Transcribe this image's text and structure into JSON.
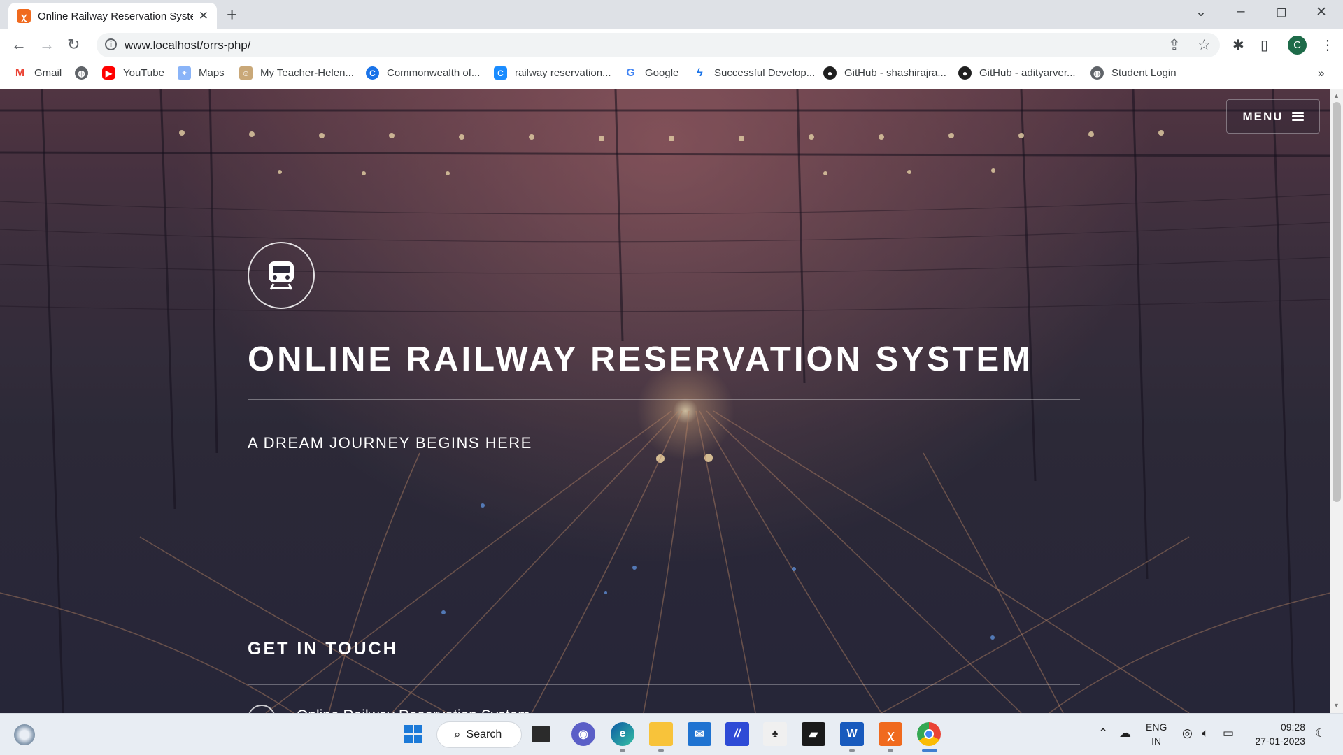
{
  "browser": {
    "tab_title": "Online Railway Reservation Syste",
    "url": "www.localhost/orrs-php/",
    "profile_initial": "C",
    "bookmarks": [
      {
        "label": "Gmail"
      },
      {
        "label": ""
      },
      {
        "label": "YouTube"
      },
      {
        "label": "Maps"
      },
      {
        "label": "My Teacher-Helen..."
      },
      {
        "label": "Commonwealth of..."
      },
      {
        "label": "railway reservation..."
      },
      {
        "label": "Google"
      },
      {
        "label": "Successful Develop..."
      },
      {
        "label": "GitHub - shashirajra..."
      },
      {
        "label": "GitHub - adityarver..."
      },
      {
        "label": "Student Login"
      }
    ]
  },
  "page": {
    "menu_label": "MENU",
    "title": "ONLINE RAILWAY RESERVATION SYSTEM",
    "subtitle": "A DREAM JOURNEY BEGINS HERE",
    "contact_heading": "GET IN TOUCH",
    "contact_first_item": "Online Railway Reservation System"
  },
  "taskbar": {
    "search_label": "Search",
    "lang_line1": "ENG",
    "lang_line2": "IN",
    "time": "09:28",
    "date": "27-01-2023"
  },
  "colors": {
    "accent_xampp": "#f06a1e",
    "profile_bg": "#1e6b49",
    "page_bg": "#2f2c39"
  }
}
